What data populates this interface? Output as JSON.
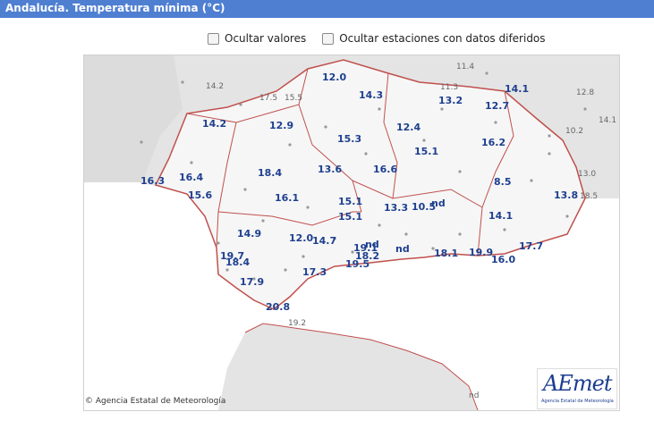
{
  "header": {
    "title": "Andalucía. Temperatura mínima (°C)"
  },
  "controls": [
    {
      "label": "Ocultar valores"
    },
    {
      "label": "Ocultar estaciones con datos diferidos"
    }
  ],
  "map": {
    "credit": "Agencia Estatal de Meteorología",
    "logo_text": "AEmet",
    "logo_subtext": "Agencia Estatal de Meteorología",
    "colors": {
      "boundary": "#c0504d",
      "value_text": "#1e3f8f",
      "outside_text": "#666666",
      "land": "#f3f3f3",
      "sea": "#ffffff"
    },
    "values": [
      {
        "t": "12.0"
      },
      {
        "t": "14.3"
      },
      {
        "t": "13.2"
      },
      {
        "t": "14.1"
      },
      {
        "t": "12.7"
      },
      {
        "t": "14.2"
      },
      {
        "t": "12.9"
      },
      {
        "t": "15.3"
      },
      {
        "t": "12.4"
      },
      {
        "t": "16.2"
      },
      {
        "t": "15.1"
      },
      {
        "t": "16.3"
      },
      {
        "t": "16.4"
      },
      {
        "t": "18.4"
      },
      {
        "t": "13.6"
      },
      {
        "t": "16.6"
      },
      {
        "t": "15.6"
      },
      {
        "t": "8.5"
      },
      {
        "t": "16.1"
      },
      {
        "t": "15.1"
      },
      {
        "t": "13.3"
      },
      {
        "t": "10.5"
      },
      {
        "t": "nd"
      },
      {
        "t": "13.8"
      },
      {
        "t": "15.1"
      },
      {
        "t": "14.1"
      },
      {
        "t": "14.9"
      },
      {
        "t": "12.0"
      },
      {
        "t": "14.7"
      },
      {
        "t": "19.1"
      },
      {
        "t": "nd"
      },
      {
        "t": "nd"
      },
      {
        "t": "18.2"
      },
      {
        "t": "18.1"
      },
      {
        "t": "19.9"
      },
      {
        "t": "17.7"
      },
      {
        "t": "19.7"
      },
      {
        "t": "18.4"
      },
      {
        "t": "19.5"
      },
      {
        "t": "16.0"
      },
      {
        "t": "17.3"
      },
      {
        "t": "17.9"
      },
      {
        "t": "20.8"
      }
    ],
    "outside_values": [
      {
        "t": "11.4"
      },
      {
        "t": "14.2"
      },
      {
        "t": "17.5"
      },
      {
        "t": "15.5"
      },
      {
        "t": "11.3"
      },
      {
        "t": "12.8"
      },
      {
        "t": "14.1"
      },
      {
        "t": "10.2"
      },
      {
        "t": "13.0"
      },
      {
        "t": "18.5"
      },
      {
        "t": "19.2"
      },
      {
        "t": "nd"
      }
    ]
  }
}
